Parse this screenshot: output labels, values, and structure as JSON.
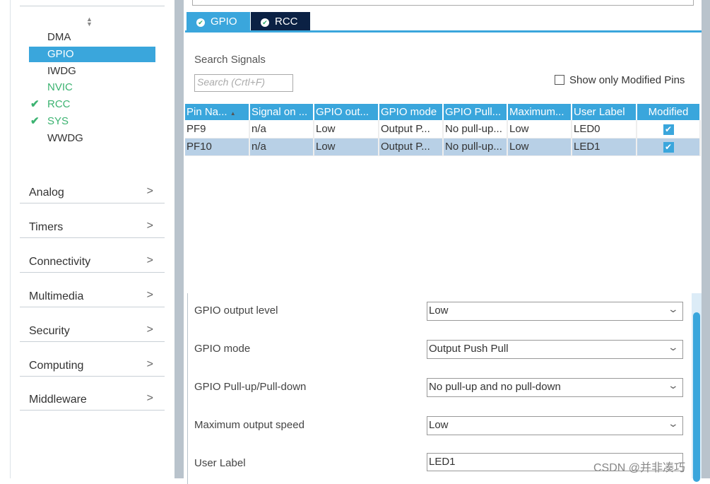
{
  "sidebar": {
    "peripherals": [
      {
        "label": "DMA",
        "state": "normal"
      },
      {
        "label": "GPIO",
        "state": "selected"
      },
      {
        "label": "IWDG",
        "state": "normal"
      },
      {
        "label": "NVIC",
        "state": "green"
      },
      {
        "label": "RCC",
        "state": "checked"
      },
      {
        "label": "SYS",
        "state": "checked"
      },
      {
        "label": "WWDG",
        "state": "normal"
      }
    ],
    "categories": [
      "Analog",
      "Timers",
      "Connectivity",
      "Multimedia",
      "Security",
      "Computing",
      "Middleware"
    ]
  },
  "tabs": [
    {
      "label": "GPIO",
      "active": true
    },
    {
      "label": "RCC",
      "active": false
    }
  ],
  "search": {
    "label": "Search Signals",
    "placeholder": "Search (Crtl+F)"
  },
  "show_modified": {
    "label": "Show only Modified Pins",
    "checked": false
  },
  "table": {
    "headers": [
      "Pin Na...",
      "Signal on ...",
      "GPIO out...",
      "GPIO mode",
      "GPIO Pull...",
      "Maximum...",
      "User Label",
      "Modified"
    ],
    "rows": [
      {
        "cells": [
          "PF9",
          "n/a",
          "Low",
          "Output P...",
          "No pull-up...",
          "Low",
          "LED0"
        ],
        "modified": true,
        "selected": false
      },
      {
        "cells": [
          "PF10",
          "n/a",
          "Low",
          "Output P...",
          "No pull-up...",
          "Low",
          "LED1"
        ],
        "modified": true,
        "selected": true
      }
    ]
  },
  "config": {
    "fields": [
      {
        "label": "GPIO output level",
        "value": "Low",
        "type": "select"
      },
      {
        "label": "GPIO mode",
        "value": "Output Push Pull",
        "type": "select"
      },
      {
        "label": "GPIO Pull-up/Pull-down",
        "value": "No pull-up and no pull-down",
        "type": "select"
      },
      {
        "label": "Maximum output speed",
        "value": "Low",
        "type": "select"
      },
      {
        "label": "User Label",
        "value": "LED1",
        "type": "text"
      }
    ]
  },
  "watermark": "CSDN @并非凑巧",
  "colors": {
    "accent": "#3aa6dc",
    "tab_dark": "#0b2144",
    "green": "#3cb371",
    "selected_row": "#b8d0e6"
  }
}
